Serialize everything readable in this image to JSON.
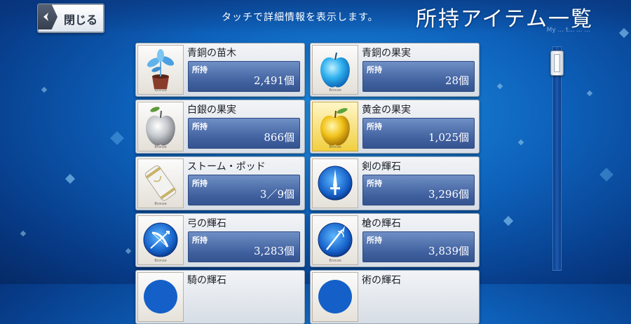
{
  "header": {
    "close_label": "閉じる",
    "hint": "タッチで詳細情報を表示します。",
    "title": "所持アイテム一覧",
    "title_sub": "My ... t... ... ..."
  },
  "items": [
    {
      "name": "青銅の苗木",
      "owned_label": "所持",
      "owned": "2,491個",
      "icon": "sapling-icon",
      "rarity": "Bronze"
    },
    {
      "name": "青銅の果実",
      "owned_label": "所持",
      "owned": "28個",
      "icon": "blue-apple-icon",
      "rarity": "Bronze"
    },
    {
      "name": "白銀の果実",
      "owned_label": "所持",
      "owned": "866個",
      "icon": "silver-apple-icon",
      "rarity": "Bronze"
    },
    {
      "name": "黄金の果実",
      "owned_label": "所持",
      "owned": "1,025個",
      "icon": "golden-apple-icon",
      "rarity": "Bronze"
    },
    {
      "name": "ストーム・ポッド",
      "owned_label": "所持",
      "owned": "3／9個",
      "icon": "storm-pod-icon",
      "rarity": "Bronze"
    },
    {
      "name": "剣の輝石",
      "owned_label": "所持",
      "owned": "3,296個",
      "icon": "saber-gem-icon",
      "rarity": ""
    },
    {
      "name": "弓の輝石",
      "owned_label": "所持",
      "owned": "3,283個",
      "icon": "archer-gem-icon",
      "rarity": "Bronze"
    },
    {
      "name": "槍の輝石",
      "owned_label": "所持",
      "owned": "3,839個",
      "icon": "lancer-gem-icon",
      "rarity": "Bronze"
    },
    {
      "name": "騎の輝石",
      "owned_label": "",
      "owned": "",
      "icon": "rider-gem-icon",
      "rarity": ""
    },
    {
      "name": "術の輝石",
      "owned_label": "",
      "owned": "",
      "icon": "caster-gem-icon",
      "rarity": ""
    }
  ],
  "colors": {
    "background": "#0d5fb8",
    "panel": "#3f5f9e",
    "accent": "#ffffff"
  }
}
